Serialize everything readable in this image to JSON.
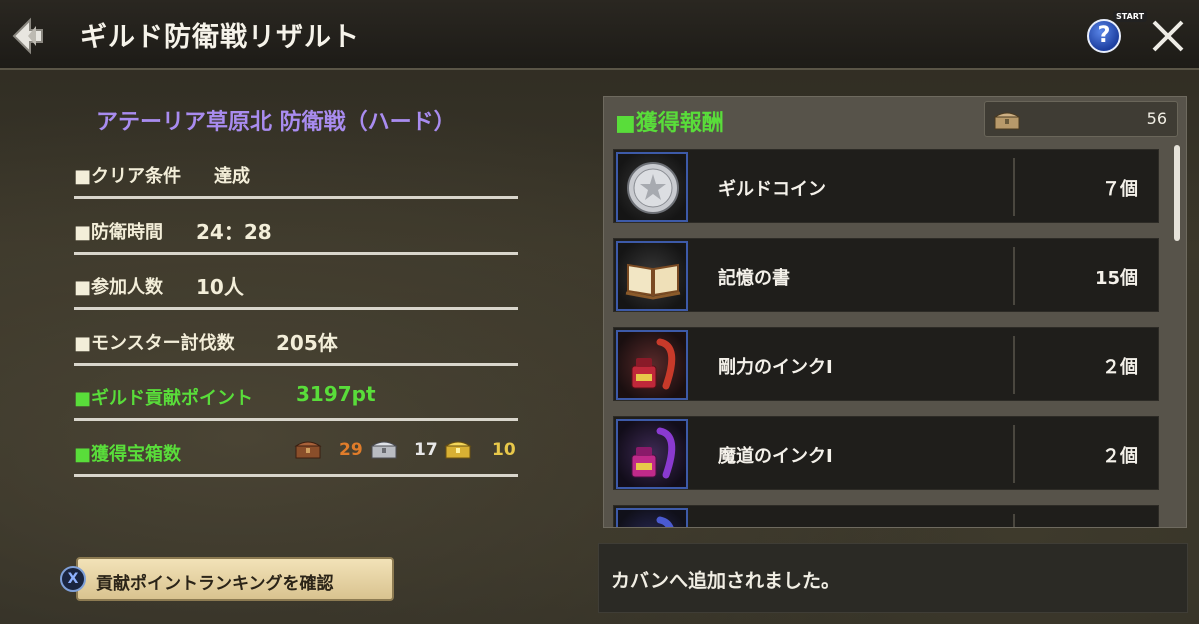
{
  "header": {
    "title": "ギルド防衛戦リザルト",
    "help_label": "?",
    "start_tag": "START"
  },
  "result": {
    "stage_title": "アテーリア草原北 防衛戦（ハード）",
    "clear_condition": {
      "label": "■クリア条件",
      "value": "達成"
    },
    "defense_time": {
      "label": "■防衛時間",
      "value": "24：28"
    },
    "participants": {
      "label": "■参加人数",
      "value": "10人"
    },
    "monsters_defeated": {
      "label": "■モンスター討伐数",
      "value": "205体"
    },
    "guild_points": {
      "label": "■ギルド貢献ポイント",
      "value": "3197pt"
    },
    "chests": {
      "label": "■獲得宝箱数",
      "bronze": "29",
      "silver": "17",
      "gold": "10"
    }
  },
  "ranking_button": {
    "key": "X",
    "label": "貢献ポイントランキングを確認"
  },
  "rewards": {
    "header": "■獲得報酬",
    "chest_total": "56",
    "items": [
      {
        "name": "ギルドコイン",
        "qty": "７個",
        "icon": "guild-coin-icon"
      },
      {
        "name": "記憶の書",
        "qty": "15個",
        "icon": "book-icon"
      },
      {
        "name": "剛力のインクⅠ",
        "qty": "２個",
        "icon": "red-ink-icon"
      },
      {
        "name": "魔道のインクⅠ",
        "qty": "２個",
        "icon": "purple-ink-icon"
      },
      {
        "name": "",
        "qty": "",
        "icon": "partial-item-icon"
      }
    ]
  },
  "message": "カバンへ追加されました。",
  "colors": {
    "accent_green": "#59dd3a",
    "stage_purple": "#a98cf0",
    "bronze": "#e07c2a",
    "gold": "#e8c84a"
  }
}
